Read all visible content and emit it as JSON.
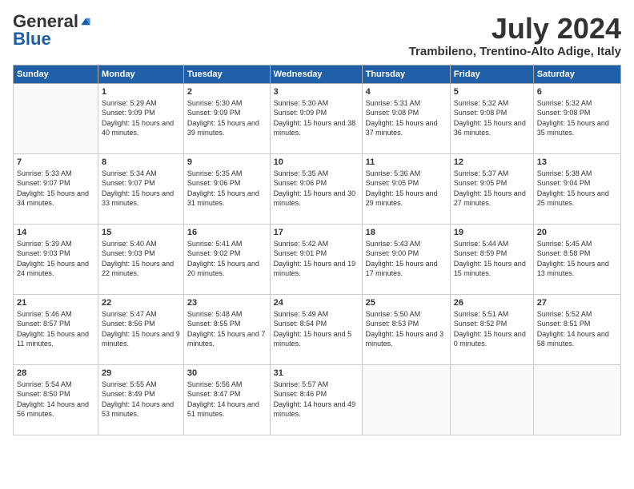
{
  "logo": {
    "general": "General",
    "blue": "Blue"
  },
  "title": {
    "month_year": "July 2024",
    "location": "Trambileno, Trentino-Alto Adige, Italy"
  },
  "days_of_week": [
    "Sunday",
    "Monday",
    "Tuesday",
    "Wednesday",
    "Thursday",
    "Friday",
    "Saturday"
  ],
  "weeks": [
    [
      {
        "day": "",
        "empty": true
      },
      {
        "day": "1",
        "sunrise": "5:29 AM",
        "sunset": "9:09 PM",
        "daylight": "15 hours and 40 minutes."
      },
      {
        "day": "2",
        "sunrise": "5:30 AM",
        "sunset": "9:09 PM",
        "daylight": "15 hours and 39 minutes."
      },
      {
        "day": "3",
        "sunrise": "5:30 AM",
        "sunset": "9:09 PM",
        "daylight": "15 hours and 38 minutes."
      },
      {
        "day": "4",
        "sunrise": "5:31 AM",
        "sunset": "9:08 PM",
        "daylight": "15 hours and 37 minutes."
      },
      {
        "day": "5",
        "sunrise": "5:32 AM",
        "sunset": "9:08 PM",
        "daylight": "15 hours and 36 minutes."
      },
      {
        "day": "6",
        "sunrise": "5:32 AM",
        "sunset": "9:08 PM",
        "daylight": "15 hours and 35 minutes."
      }
    ],
    [
      {
        "day": "7",
        "sunrise": "5:33 AM",
        "sunset": "9:07 PM",
        "daylight": "15 hours and 34 minutes."
      },
      {
        "day": "8",
        "sunrise": "5:34 AM",
        "sunset": "9:07 PM",
        "daylight": "15 hours and 33 minutes."
      },
      {
        "day": "9",
        "sunrise": "5:35 AM",
        "sunset": "9:06 PM",
        "daylight": "15 hours and 31 minutes."
      },
      {
        "day": "10",
        "sunrise": "5:35 AM",
        "sunset": "9:06 PM",
        "daylight": "15 hours and 30 minutes."
      },
      {
        "day": "11",
        "sunrise": "5:36 AM",
        "sunset": "9:05 PM",
        "daylight": "15 hours and 29 minutes."
      },
      {
        "day": "12",
        "sunrise": "5:37 AM",
        "sunset": "9:05 PM",
        "daylight": "15 hours and 27 minutes."
      },
      {
        "day": "13",
        "sunrise": "5:38 AM",
        "sunset": "9:04 PM",
        "daylight": "15 hours and 25 minutes."
      }
    ],
    [
      {
        "day": "14",
        "sunrise": "5:39 AM",
        "sunset": "9:03 PM",
        "daylight": "15 hours and 24 minutes."
      },
      {
        "day": "15",
        "sunrise": "5:40 AM",
        "sunset": "9:03 PM",
        "daylight": "15 hours and 22 minutes."
      },
      {
        "day": "16",
        "sunrise": "5:41 AM",
        "sunset": "9:02 PM",
        "daylight": "15 hours and 20 minutes."
      },
      {
        "day": "17",
        "sunrise": "5:42 AM",
        "sunset": "9:01 PM",
        "daylight": "15 hours and 19 minutes."
      },
      {
        "day": "18",
        "sunrise": "5:43 AM",
        "sunset": "9:00 PM",
        "daylight": "15 hours and 17 minutes."
      },
      {
        "day": "19",
        "sunrise": "5:44 AM",
        "sunset": "8:59 PM",
        "daylight": "15 hours and 15 minutes."
      },
      {
        "day": "20",
        "sunrise": "5:45 AM",
        "sunset": "8:58 PM",
        "daylight": "15 hours and 13 minutes."
      }
    ],
    [
      {
        "day": "21",
        "sunrise": "5:46 AM",
        "sunset": "8:57 PM",
        "daylight": "15 hours and 11 minutes."
      },
      {
        "day": "22",
        "sunrise": "5:47 AM",
        "sunset": "8:56 PM",
        "daylight": "15 hours and 9 minutes."
      },
      {
        "day": "23",
        "sunrise": "5:48 AM",
        "sunset": "8:55 PM",
        "daylight": "15 hours and 7 minutes."
      },
      {
        "day": "24",
        "sunrise": "5:49 AM",
        "sunset": "8:54 PM",
        "daylight": "15 hours and 5 minutes."
      },
      {
        "day": "25",
        "sunrise": "5:50 AM",
        "sunset": "8:53 PM",
        "daylight": "15 hours and 3 minutes."
      },
      {
        "day": "26",
        "sunrise": "5:51 AM",
        "sunset": "8:52 PM",
        "daylight": "15 hours and 0 minutes."
      },
      {
        "day": "27",
        "sunrise": "5:52 AM",
        "sunset": "8:51 PM",
        "daylight": "14 hours and 58 minutes."
      }
    ],
    [
      {
        "day": "28",
        "sunrise": "5:54 AM",
        "sunset": "8:50 PM",
        "daylight": "14 hours and 56 minutes."
      },
      {
        "day": "29",
        "sunrise": "5:55 AM",
        "sunset": "8:49 PM",
        "daylight": "14 hours and 53 minutes."
      },
      {
        "day": "30",
        "sunrise": "5:56 AM",
        "sunset": "8:47 PM",
        "daylight": "14 hours and 51 minutes."
      },
      {
        "day": "31",
        "sunrise": "5:57 AM",
        "sunset": "8:46 PM",
        "daylight": "14 hours and 49 minutes."
      },
      {
        "day": "",
        "empty": true
      },
      {
        "day": "",
        "empty": true
      },
      {
        "day": "",
        "empty": true
      }
    ]
  ],
  "labels": {
    "sunrise": "Sunrise:",
    "sunset": "Sunset:",
    "daylight": "Daylight:"
  }
}
